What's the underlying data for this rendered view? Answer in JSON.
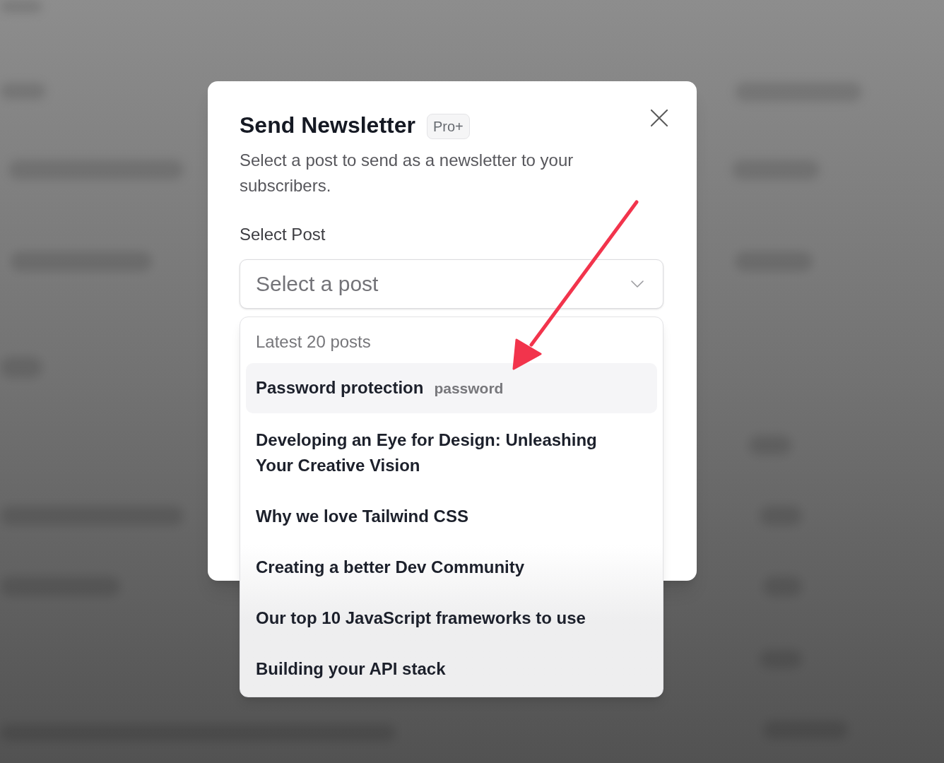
{
  "dialog": {
    "title": "Send Newsletter",
    "badge": "Pro+",
    "description": "Select a post to send as a newsletter to your subscribers."
  },
  "field": {
    "label": "Select Post",
    "placeholder": "Select a post",
    "expanded": true
  },
  "dropdown": {
    "group_label": "Latest 20 posts",
    "options": [
      {
        "label": "Password protection",
        "tag": "password",
        "highlighted": true
      },
      {
        "label": "Developing an Eye for Design: Unleashing Your Creative Vision",
        "highlighted": false
      },
      {
        "label": "Why we love Tailwind CSS",
        "highlighted": false
      },
      {
        "label": "Creating a better Dev Community",
        "highlighted": false
      },
      {
        "label": "Our top 10 JavaScript frameworks to use",
        "highlighted": false
      },
      {
        "label": "Building your API stack",
        "highlighted": false
      }
    ]
  }
}
